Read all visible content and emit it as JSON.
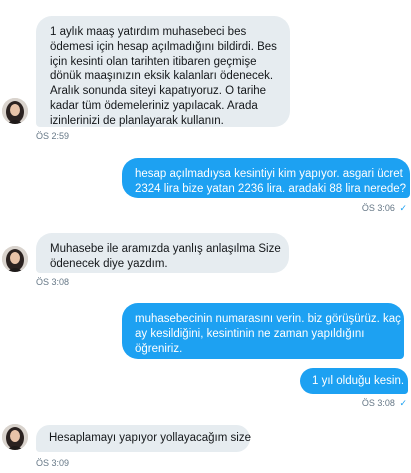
{
  "messages": [
    {
      "direction": "incoming",
      "lines": [
        "1 aylık maaş yatırdım muhasebeci bes",
        "ödemesi için hesap açılmadığını bildirdi. Bes",
        "için kesinti olan tarihten itibaren geçmişe",
        "dönük maaşınızın eksik kalanları ödenecek.",
        "Aralık sonunda siteyi kapatıyoruz. O tarihe",
        "kadar tüm ödemeleriniz yapılacak. Arada",
        "izinlerinizi de planlayarak kullanın."
      ],
      "time": "ÖS 2:59"
    },
    {
      "direction": "outgoing",
      "lines": [
        "hesap açılmadıysa kesintiyi kim yapıyor. asgari ücret",
        "2324 lira bize yatan 2236 lira. aradaki 88 lira nerede?"
      ],
      "time": "ÖS 3:06",
      "status_icon": "read-check-icon"
    },
    {
      "direction": "incoming",
      "lines": [
        "Muhasebe ile aramızda yanlış anlaşılma Size",
        "ödenecek diye yazdım."
      ],
      "time": "ÖS 3:08"
    },
    {
      "direction": "outgoing",
      "lines": [
        "muhasebecinin numarasını verin. biz görüşürüz. kaç",
        "ay kesildiğini, kesintinin ne zaman yapıldığını",
        "öğreniriz."
      ]
    },
    {
      "direction": "outgoing",
      "lines": [
        "1 yıl olduğu kesin."
      ],
      "time": "ÖS 3:08",
      "status_icon": "read-check-icon"
    },
    {
      "direction": "incoming",
      "lines": [
        "Hesaplamayı yapıyor yollayacağım size"
      ],
      "time": "ÖS 3:09"
    }
  ],
  "colors": {
    "incoming_bubble": "#e6ecf0",
    "outgoing_bubble": "#1da1f2",
    "timestamp": "#657786",
    "check": "#1da1f2"
  },
  "icons": {
    "check": "✓"
  }
}
